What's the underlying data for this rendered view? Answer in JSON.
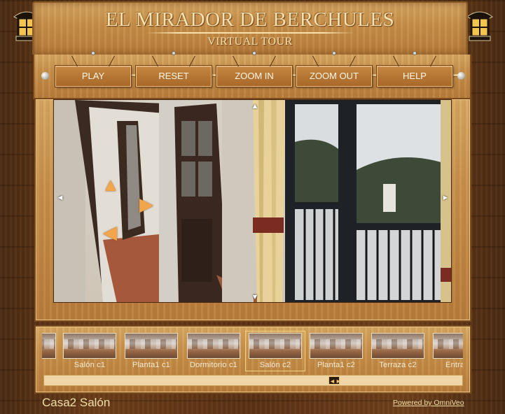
{
  "header": {
    "title": "EL MIRADOR DE BERCHULES",
    "subtitle": "VIRTUAL TOUR"
  },
  "nav": {
    "buttons": [
      {
        "label": "PLAY"
      },
      {
        "label": "RESET"
      },
      {
        "label": "ZOOM IN"
      },
      {
        "label": "ZOOM OUT"
      },
      {
        "label": "HELP"
      }
    ]
  },
  "viewer": {
    "controls": {
      "up": "▲",
      "down": "▼",
      "left": "◄",
      "right": "►"
    }
  },
  "thumbnails": [
    {
      "label": "Salón c1",
      "selected": false
    },
    {
      "label": "Planta1 c1",
      "selected": false
    },
    {
      "label": "Dormitorio c1",
      "selected": false
    },
    {
      "label": "Salón c2",
      "selected": true
    },
    {
      "label": "Planta1 c2",
      "selected": false
    },
    {
      "label": "Terraza c2",
      "selected": false
    },
    {
      "label": "Entrada",
      "selected": false
    }
  ],
  "scroll": {
    "glyph": "◄►"
  },
  "footer": {
    "scene_name": "Casa2 Salón",
    "powered_by": "Powered by OmniVeo"
  },
  "colors": {
    "wood_dark": "#5a3114",
    "wood_light": "#c8904a",
    "text_cream": "#f6e2b0",
    "button_face": "#b47434",
    "hotspot_orange": "#f2a54b"
  }
}
